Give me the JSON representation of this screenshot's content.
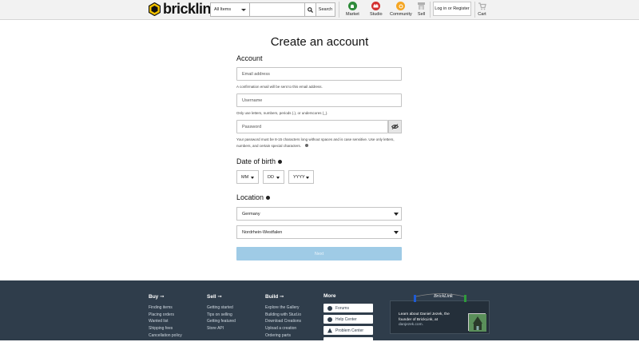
{
  "header": {
    "brand": "bricklink",
    "category_select": "All Items",
    "search_placeholder": "",
    "search_button": "Search",
    "nav": [
      {
        "label": "Market",
        "color": "#2e8b3a"
      },
      {
        "label": "Studio",
        "color": "#d32f2f"
      },
      {
        "label": "Community",
        "color": "#f5a623"
      },
      {
        "label": "Sell",
        "color": "#9e9e9e"
      }
    ],
    "login": "Log in or Register",
    "cart": "Cart"
  },
  "form": {
    "title": "Create an account",
    "account_heading": "Account",
    "email_placeholder": "Email address",
    "email_hint": "A confirmation email will be sent to this email address.",
    "username_placeholder": "Username",
    "username_hint": "Only use letters, numbers, periods (.), or underscores (_).",
    "password_placeholder": "Password",
    "password_hint": "Your password must be 8-15 characters long without spaces and is case sensitive. Use only letters, numbers, and certain special characters.",
    "dob_heading": "Date of birth",
    "dob_month": "MM",
    "dob_day": "DD",
    "dob_year": "YYYY",
    "location_heading": "Location",
    "country": "Germany",
    "region": "Nordrhein-Westfalen",
    "next": "Next"
  },
  "footer": {
    "buy": {
      "heading": "Buy ➞",
      "links": [
        "Finding items",
        "Placing orders",
        "Wanted list",
        "Shipping fees",
        "Cancellation policy"
      ]
    },
    "sell": {
      "heading": "Sell ➞",
      "links": [
        "Getting started",
        "Tips on selling",
        "Getting featured",
        "Store API"
      ]
    },
    "build": {
      "heading": "Build ➞",
      "links": [
        "Explore the Gallery",
        "Building with Stud.io",
        "Download Creations",
        "Upload a creation",
        "Ordering parts"
      ]
    },
    "more": {
      "heading": "More",
      "buttons": [
        "Forums",
        "Help Center",
        "Problem Center"
      ]
    },
    "promo": {
      "signature": "BrickLink",
      "text_a": "Learn about Daniel Jezek, the founder of BrickLink, at",
      "text_b": "danjezek.com."
    }
  }
}
